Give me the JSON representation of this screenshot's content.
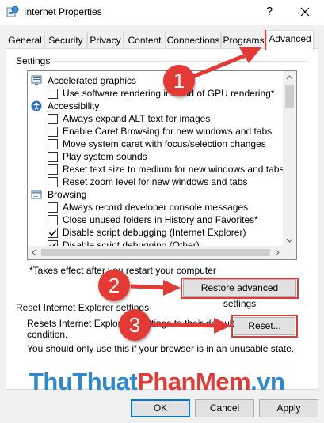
{
  "window": {
    "title": "Internet Properties",
    "help_label": "?"
  },
  "tabs": [
    {
      "label": "General"
    },
    {
      "label": "Security"
    },
    {
      "label": "Privacy"
    },
    {
      "label": "Content"
    },
    {
      "label": "Connections"
    },
    {
      "label": "Programs"
    },
    {
      "label": "Advanced",
      "active": true
    }
  ],
  "settings": {
    "group_label": "Settings",
    "items": [
      {
        "type": "category",
        "icon": "monitor-icon",
        "label": "Accelerated graphics"
      },
      {
        "type": "checkbox",
        "checked": false,
        "label": "Use software rendering instead of GPU rendering*"
      },
      {
        "type": "category",
        "icon": "accessibility-icon",
        "label": "Accessibility"
      },
      {
        "type": "checkbox",
        "checked": false,
        "label": "Always expand ALT text for images"
      },
      {
        "type": "checkbox",
        "checked": false,
        "label": "Enable Caret Browsing for new windows and tabs"
      },
      {
        "type": "checkbox",
        "checked": false,
        "label": "Move system caret with focus/selection changes"
      },
      {
        "type": "checkbox",
        "checked": false,
        "label": "Play system sounds"
      },
      {
        "type": "checkbox",
        "checked": false,
        "label": "Reset text size to medium for new windows and tabs"
      },
      {
        "type": "checkbox",
        "checked": false,
        "label": "Reset zoom level for new windows and tabs"
      },
      {
        "type": "category",
        "icon": "browsing-icon",
        "label": "Browsing"
      },
      {
        "type": "checkbox",
        "checked": false,
        "label": "Always record developer console messages"
      },
      {
        "type": "checkbox",
        "checked": false,
        "label": "Close unused folders in History and Favorites*"
      },
      {
        "type": "checkbox",
        "checked": true,
        "label": "Disable script debugging (Internet Explorer)"
      },
      {
        "type": "checkbox",
        "checked": true,
        "label": "Disable script debugging (Other)"
      }
    ],
    "restart_note": "*Takes effect after you restart your computer",
    "restore_button": "Restore advanced settings"
  },
  "reset": {
    "group_label": "Reset Internet Explorer settings",
    "description_line1": "Resets Internet Explorer's settings to their default",
    "description_line2": "condition.",
    "warning": "You should only use this if your browser is in an unusable state.",
    "reset_button": "Reset..."
  },
  "footer": {
    "ok": "OK",
    "cancel": "Cancel",
    "apply": "Apply"
  },
  "annotations": {
    "step1": "1",
    "step2": "2",
    "step3": "3",
    "accent": "#e53935"
  },
  "watermark": {
    "part1": "ThuThuat",
    "part2": "PhanMem",
    "part3": ".vn"
  }
}
